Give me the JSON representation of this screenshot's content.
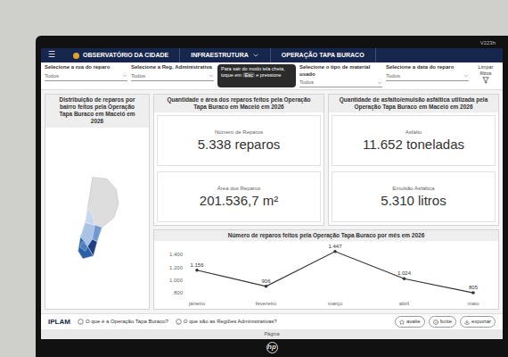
{
  "monitor": {
    "model": "V223h",
    "brand": "hp"
  },
  "nav": {
    "menu_icon": "☰",
    "items": [
      {
        "label": "OBSERVATÓRIO DA CIDADE",
        "has_dropdown": false
      },
      {
        "label": "INFRAESTRUTURA",
        "has_dropdown": true
      },
      {
        "label": "OPERAÇÃO TAPA BURACO",
        "has_dropdown": false
      }
    ]
  },
  "fullscreen_notice": {
    "before": "Para sair do modo tela cheia, toque em",
    "key": "Esc",
    "after": "e pressione"
  },
  "filters": [
    {
      "label": "Selecione a rua do reparo",
      "value": "Todos"
    },
    {
      "label": "Selecione a Reg. Administrativa",
      "value": "Todos"
    },
    {
      "label": "Selecione o tipo de material usado",
      "value": "Todos"
    },
    {
      "label": "Selecione a data do reparo",
      "value": "Todos"
    }
  ],
  "clear_filters": "Limpar filtros",
  "map_card": {
    "title": "Distribuição de reparos por bairro feitos pela Operação Tapa Buraco em Maceió em 2026"
  },
  "repairs_card": {
    "title": "Quantidade e área dos reparos feitos pela Operação Tapa Buraco em Maceió em 2026",
    "metrics": [
      {
        "label": "Número de Reparos",
        "value": "5.338 reparos"
      },
      {
        "label": "Área dos Reparos",
        "value": "201.536,7 m²"
      }
    ]
  },
  "material_card": {
    "title": "Quantidade de asfalto/emulsão asfáltica utilizada pela Operação Tapa Buraco em Maceió em 2026",
    "metrics": [
      {
        "label": "Asfalto",
        "value": "11.652 toneladas"
      },
      {
        "label": "Emulsão Asfáltica",
        "value": "5.310 litros"
      }
    ]
  },
  "chart": {
    "title": "Número de reparos feitos pela Operação Tapa Buraco por mês em 2026",
    "y_ticks": [
      "800",
      "1.000",
      "1.200",
      "1.400"
    ],
    "x_labels": [
      "janeiro",
      "fevereiro",
      "março",
      "abril",
      "maio"
    ],
    "values": [
      1156,
      906,
      1447,
      1024,
      805
    ],
    "point_labels": [
      "1.156",
      "906",
      "1.447",
      "1.024",
      "805"
    ]
  },
  "footer": {
    "logo": "IPLAM",
    "links": [
      "O que é a Operação Tapa Buraco?",
      "O que são as Regiões Administrativas?"
    ],
    "buttons": [
      "avalie",
      "fonte",
      "exportar"
    ]
  },
  "page_bar": {
    "label": "Página"
  }
}
